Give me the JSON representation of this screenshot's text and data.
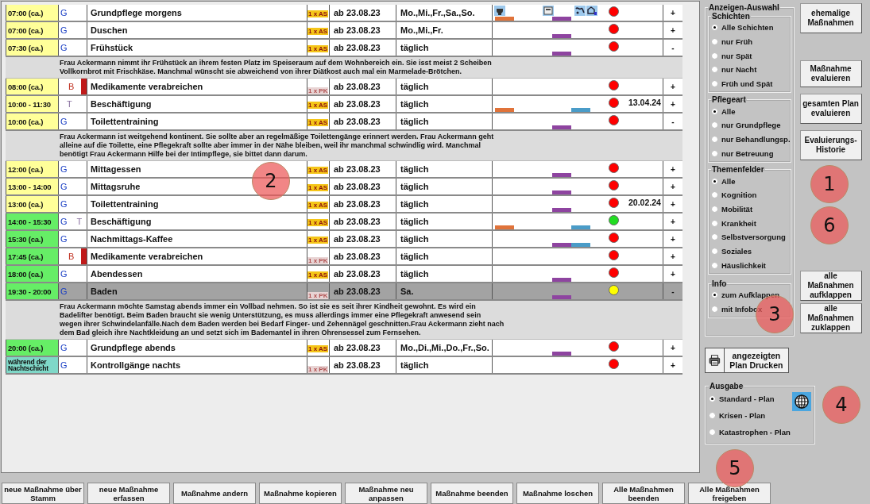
{
  "rows": [
    {
      "time": "07:00 (ca.)",
      "color": "#ffff99",
      "codes": [
        {
          "text": "G",
          "kind": "grund"
        }
      ],
      "med_flag": false,
      "name": "Grundpflege morgens",
      "dose": {
        "text": "1 x AS",
        "kind": "as"
      },
      "start": "ab 23.08.23",
      "days": "Mo.,Mi.,Fr.,Sa.,So.",
      "segments": [
        {
          "kind": "early"
        },
        {
          "kind": "mid"
        }
      ],
      "icons": true,
      "status": {
        "color": "#ff0000"
      },
      "sign": "+",
      "selected": false
    },
    {
      "time": "07:00 (ca.)",
      "color": "#ffff99",
      "codes": [
        {
          "text": "G",
          "kind": "grund"
        }
      ],
      "med_flag": false,
      "name": "Duschen",
      "dose": {
        "text": "1 x AS",
        "kind": "as"
      },
      "start": "ab 23.08.23",
      "days": "Mo.,Mi.,Fr.",
      "segments": [
        {
          "kind": "mid"
        }
      ],
      "icons": false,
      "status": {
        "color": "#ff0000"
      },
      "sign": "+",
      "selected": false
    },
    {
      "time": "07:30 (ca.)",
      "color": "#ffff99",
      "codes": [
        {
          "text": "G",
          "kind": "grund"
        }
      ],
      "med_flag": false,
      "name": "Frühstück",
      "dose": {
        "text": "1 x AS",
        "kind": "as"
      },
      "start": "ab 23.08.23",
      "days": "täglich",
      "segments": [
        {
          "kind": "mid"
        }
      ],
      "icons": false,
      "status": {
        "color": "#ff0000"
      },
      "sign": "-",
      "selected": false,
      "info": "Frau Ackermann nimmt ihr Frühstück an ihrem festen Platz im Speiseraum auf dem Wohnbereich ein. Sie isst meist 2 Scheiben Vollkornbrot mit Frischkäse. Manchmal wünscht sie abweichend von ihrer Diätkost auch mal ein Marmelade-Brötchen."
    },
    {
      "time": "08:00 (ca.)",
      "color": "#ffff99",
      "codes": [
        {
          "text": "B",
          "kind": "behandlung"
        }
      ],
      "med_flag": true,
      "name": "Medikamente verabreichen",
      "dose": {
        "text": "1 x PK",
        "kind": "pk"
      },
      "start": "ab 23.08.23",
      "days": "täglich",
      "segments": [],
      "icons": false,
      "status": {
        "color": "#ff0000"
      },
      "sign": "+",
      "selected": false
    },
    {
      "time": "10:00 - 11:30",
      "color": "#ffff99",
      "codes": [
        {
          "text": "T",
          "kind": "betreuung"
        }
      ],
      "med_flag": false,
      "name": "Beschäftigung",
      "dose": {
        "text": "1 x AS",
        "kind": "as"
      },
      "start": "ab 23.08.23",
      "days": "täglich",
      "segments": [
        {
          "kind": "early"
        },
        {
          "kind": "late"
        }
      ],
      "icons": false,
      "status": {
        "color": "#ff0000"
      },
      "eval_date": "13.04.24",
      "sign": "+",
      "selected": false
    },
    {
      "time": "10:00 (ca.)",
      "color": "#ffff99",
      "codes": [
        {
          "text": "G",
          "kind": "grund"
        }
      ],
      "med_flag": false,
      "name": "Toilettentraining",
      "dose": {
        "text": "1 x AS",
        "kind": "as"
      },
      "start": "ab 23.08.23",
      "days": "täglich",
      "segments": [
        {
          "kind": "mid"
        }
      ],
      "icons": false,
      "status": {
        "color": "#ff0000"
      },
      "sign": "-",
      "selected": false,
      "info": "Frau Ackermann ist weitgehend kontinent. Sie sollte aber an regelmäßige Toilettengänge erinnert werden. Frau Ackermann geht alleine auf die Toilette, eine Pflegekraft sollte aber immer in der Nähe bleiben, weil ihr manchmal schwindlig wird. Manchmal benötigt Frau Ackermann Hilfe bei der Intimpflege, sie bittet dann darum."
    },
    {
      "time": "12:00 (ca.)",
      "color": "#ffff99",
      "codes": [
        {
          "text": "G",
          "kind": "grund"
        }
      ],
      "med_flag": false,
      "name": "Mittagessen",
      "dose": {
        "text": "1 x AS",
        "kind": "as"
      },
      "start": "ab 23.08.23",
      "days": "täglich",
      "segments": [
        {
          "kind": "mid"
        }
      ],
      "icons": false,
      "status": {
        "color": "#ff0000"
      },
      "sign": "+",
      "selected": false
    },
    {
      "time": "13:00 - 14:00",
      "color": "#ffff99",
      "codes": [
        {
          "text": "G",
          "kind": "grund"
        }
      ],
      "med_flag": false,
      "name": "Mittagsruhe",
      "dose": {
        "text": "1 x AS",
        "kind": "as"
      },
      "start": "ab 23.08.23",
      "days": "täglich",
      "segments": [
        {
          "kind": "mid"
        }
      ],
      "icons": false,
      "status": {
        "color": "#ff0000"
      },
      "sign": "+",
      "selected": false
    },
    {
      "time": "13:00 (ca.)",
      "color": "#ffff99",
      "codes": [
        {
          "text": "G",
          "kind": "grund"
        }
      ],
      "med_flag": false,
      "name": "Toilettentraining",
      "dose": {
        "text": "1 x AS",
        "kind": "as"
      },
      "start": "ab 23.08.23",
      "days": "täglich",
      "segments": [
        {
          "kind": "mid"
        }
      ],
      "icons": false,
      "status": {
        "color": "#ff0000"
      },
      "eval_date": "20.02.24",
      "sign": "+",
      "selected": false
    },
    {
      "time": "14:00 - 15:30",
      "color": "#66ee66",
      "codes": [
        {
          "text": "G",
          "kind": "grund"
        },
        {
          "text": "T",
          "kind": "betreuung"
        }
      ],
      "med_flag": false,
      "name": "Beschäftigung",
      "dose": {
        "text": "1 x AS",
        "kind": "as"
      },
      "start": "ab 23.08.23",
      "days": "täglich",
      "segments": [
        {
          "kind": "early"
        },
        {
          "kind": "late"
        }
      ],
      "icons": false,
      "status": {
        "color": "#22dd22"
      },
      "sign": "+",
      "selected": false
    },
    {
      "time": "15:30 (ca.)",
      "color": "#66ee66",
      "codes": [
        {
          "text": "G",
          "kind": "grund"
        }
      ],
      "med_flag": false,
      "name": "Nachmittags-Kaffee",
      "dose": {
        "text": "1 x AS",
        "kind": "as"
      },
      "start": "ab 23.08.23",
      "days": "täglich",
      "segments": [
        {
          "kind": "mid"
        },
        {
          "kind": "late"
        }
      ],
      "icons": false,
      "status": {
        "color": "#ff0000"
      },
      "sign": "+",
      "selected": false
    },
    {
      "time": "17:45 (ca.)",
      "color": "#66ee66",
      "codes": [
        {
          "text": "B",
          "kind": "behandlung"
        }
      ],
      "med_flag": true,
      "name": "Medikamente verabreichen",
      "dose": {
        "text": "1 x PK",
        "kind": "pk"
      },
      "start": "ab 23.08.23",
      "days": "täglich",
      "segments": [],
      "icons": false,
      "status": {
        "color": "#ff0000"
      },
      "sign": "+",
      "selected": false
    },
    {
      "time": "18:00 (ca.)",
      "color": "#66ee66",
      "codes": [
        {
          "text": "G",
          "kind": "grund"
        }
      ],
      "med_flag": false,
      "name": "Abendessen",
      "dose": {
        "text": "1 x AS",
        "kind": "as"
      },
      "start": "ab 23.08.23",
      "days": "täglich",
      "segments": [
        {
          "kind": "mid"
        }
      ],
      "icons": false,
      "status": {
        "color": "#ff0000"
      },
      "sign": "+",
      "selected": false
    },
    {
      "time": "19:30 - 20:00",
      "color": "#66ee66",
      "codes": [
        {
          "text": "G",
          "kind": "grund"
        }
      ],
      "med_flag": false,
      "name": "Baden",
      "dose": {
        "text": "1 x PK",
        "kind": "pk"
      },
      "start": "ab 23.08.23",
      "days": "Sa.",
      "segments": [
        {
          "kind": "mid"
        }
      ],
      "icons": false,
      "status": {
        "color": "#ffff00"
      },
      "sign": "-",
      "selected": true,
      "info": "Frau Ackermann möchte Samstag abends immer ein Vollbad nehmen. So ist sie es seit ihrer Kindheit gewohnt. Es wird ein Badelifter benötigt. Beim Baden braucht sie wenig Unterstützung, es muss allerdings immer eine Pflegekraft anwesend sein wegen ihrer Schwindelanfälle.Nach dem Baden werden bei Bedarf Finger- und Zehennägel geschnitten.Frau Ackermann zieht nach dem Bad gleich ihre Nachtkleidung an und setzt sich im Bademantel in ihren Ohrensessel zum Fernsehen."
    },
    {
      "time": "20:00 (ca.)",
      "color": "#66ee66",
      "codes": [
        {
          "text": "G",
          "kind": "grund"
        }
      ],
      "med_flag": false,
      "name": "Grundpflege abends",
      "dose": {
        "text": "1 x AS",
        "kind": "as"
      },
      "start": "ab 23.08.23",
      "days": "Mo.,Di.,Mi.,Do.,Fr.,So.",
      "segments": [
        {
          "kind": "mid"
        }
      ],
      "icons": false,
      "status": {
        "color": "#ff0000"
      },
      "sign": "+",
      "selected": false
    },
    {
      "time": "während der Nachtschicht",
      "color": "#7fd8c8",
      "codes": [
        {
          "text": "G",
          "kind": "grund"
        }
      ],
      "med_flag": false,
      "name": "Kontrollgänge nachts",
      "dose": {
        "text": "1 x PK",
        "kind": "pk"
      },
      "start": "ab 23.08.23",
      "days": "täglich",
      "segments": [],
      "icons": false,
      "status": {
        "color": "#ff0000"
      },
      "sign": "+",
      "selected": false
    }
  ],
  "filter": {
    "title": "Anzeigen-Auswahl",
    "groups": [
      {
        "title": "Schichten",
        "options": [
          {
            "label": "Alle Schichten",
            "selected": true
          },
          {
            "label": "nur Früh",
            "selected": false
          },
          {
            "label": "nur Spät",
            "selected": false
          },
          {
            "label": "nur Nacht",
            "selected": false
          },
          {
            "label": "Früh und Spät",
            "selected": false
          }
        ]
      },
      {
        "title": "Pflegeart",
        "options": [
          {
            "label": "Alle",
            "selected": true
          },
          {
            "label": "nur Grundpflege",
            "selected": false
          },
          {
            "label": "nur Behandlungsp.",
            "selected": false
          },
          {
            "label": "nur Betreuung",
            "selected": false
          }
        ]
      },
      {
        "title": "Themenfelder",
        "options": [
          {
            "label": "Alle",
            "selected": true
          },
          {
            "label": "Kognition",
            "selected": false
          },
          {
            "label": "Mobilität",
            "selected": false
          },
          {
            "label": "Krankheit",
            "selected": false
          },
          {
            "label": "Selbstversorgung",
            "selected": false
          },
          {
            "label": "Soziales",
            "selected": false
          },
          {
            "label": "Häuslichkeit",
            "selected": false
          }
        ]
      },
      {
        "title": "Info",
        "options": [
          {
            "label": "zum Aufklappen",
            "selected": true
          },
          {
            "label": "mit Infobox",
            "selected": false
          }
        ]
      }
    ]
  },
  "side_buttons": [
    "ehemalige Maßnahmen",
    "Maßnahme evaluieren",
    "gesamten Plan evaluieren",
    "Evaluierungs-Historie"
  ],
  "expand_buttons": [
    "alle Maßnahmen aufklappen",
    "alle Maßnahmen zuklappen"
  ],
  "print_button": "angezeigten Plan Drucken",
  "output": {
    "title": "Ausgabe",
    "options": [
      {
        "label": "Standard - Plan",
        "selected": true
      },
      {
        "label": "Krisen - Plan",
        "selected": false
      },
      {
        "label": "Katastrophen - Plan",
        "selected": false
      }
    ]
  },
  "bottom_buttons": [
    "neue Maßnahme über Stamm",
    "neue Maßnahme erfassen",
    "Maßnahme andern",
    "Maßnahme kopieren",
    "Maßnahme neu anpassen",
    "Maßnahme beenden",
    "Maßnahme loschen",
    "Alle Maßnahmen beenden",
    "Alle Maßnahmen freigeben"
  ],
  "callouts": [
    "1",
    "2",
    "3",
    "4",
    "5",
    "6"
  ]
}
